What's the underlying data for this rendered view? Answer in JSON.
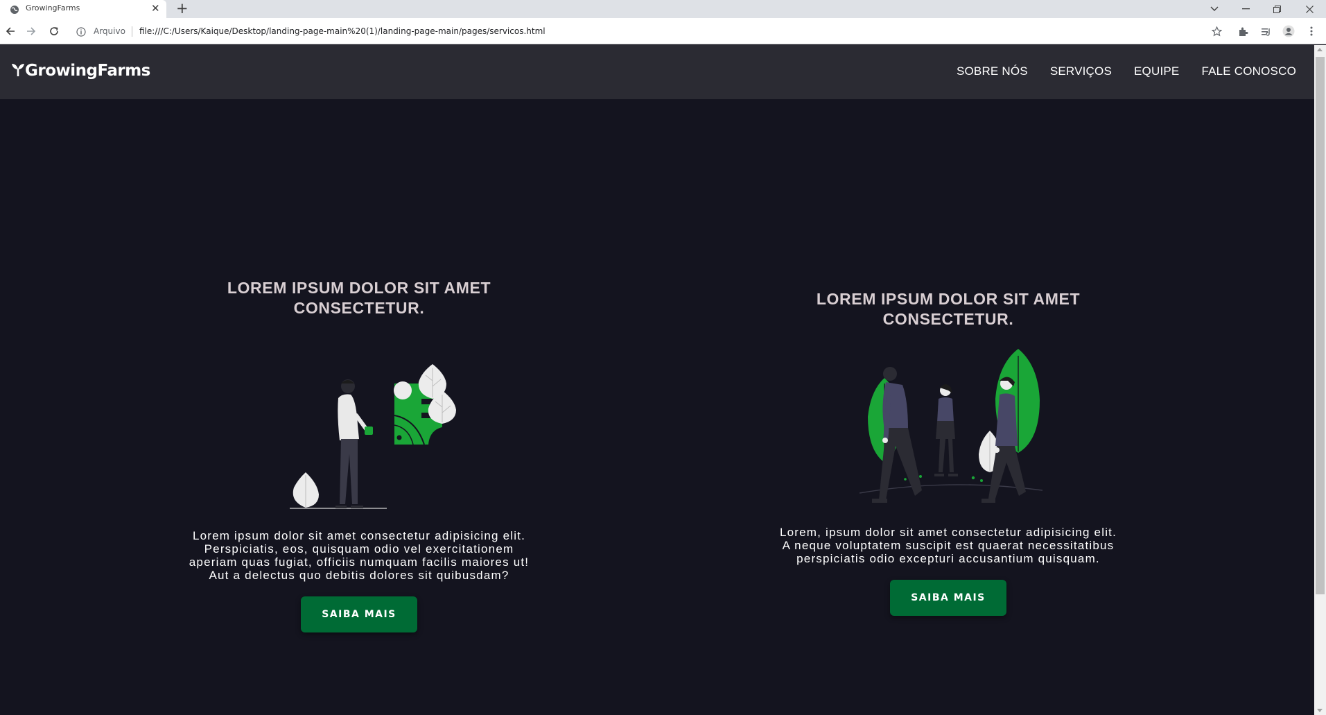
{
  "browser": {
    "tab_title": "GrowingFarms",
    "address_scheme_label": "Arquivo",
    "url": "file:///C:/Users/Kaique/Desktop/landing-page-main%20(1)/landing-page-main/pages/servicos.html"
  },
  "header": {
    "logo_text": "GrowingFarms",
    "nav": [
      {
        "label": "SOBRE NÓS"
      },
      {
        "label": "SERVIÇOS"
      },
      {
        "label": "EQUIPE"
      },
      {
        "label": "FALE CONOSCO"
      }
    ]
  },
  "cards": [
    {
      "title_lines": [
        "LOREM IPSUM DOLOR SIT AMET",
        "CONSECTETUR."
      ],
      "text_lines": [
        "Lorem ipsum dolor sit amet consectetur adipisicing elit.",
        "Perspiciatis, eos, quisquam odio vel exercitationem",
        "aperiam quas fugiat, officiis numquam facilis maiores ut!",
        "Aut a delectus quo debitis dolores sit quibusdam?"
      ],
      "button_label": "SAIBA MAIS"
    },
    {
      "title_lines": [
        "LOREM IPSUM DOLOR SIT AMET",
        "CONSECTETUR."
      ],
      "text_lines": [
        "Lorem, ipsum dolor sit amet consectetur adipisicing elit.",
        "A neque voluptatem suscipit est quaerat necessitatibus",
        "perspiciatis odio excepturi accusantium quisquam."
      ],
      "button_label": "SAIBA MAIS"
    }
  ],
  "colors": {
    "page_background": "#14141f",
    "header_background": "#2b2b33",
    "button_green": "#006b35",
    "illustration_green": "#1aa637",
    "title_text": "#d9cfd3"
  }
}
